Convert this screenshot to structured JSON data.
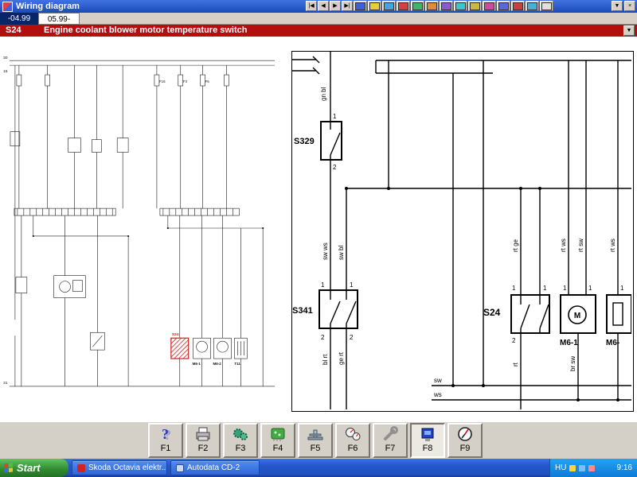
{
  "titlebar": {
    "title": "Wiring diagram",
    "nav_first": "|◀",
    "nav_prev": "◀",
    "nav_next": "▶",
    "nav_last": "▶|",
    "dropdown": "▼",
    "close": "×"
  },
  "date_tabs": {
    "tab1": "-04.99",
    "tab2": "05.99-"
  },
  "banner": {
    "code": "S24",
    "title": "Engine coolant blower motor temperature switch",
    "dropdown": "▼"
  },
  "left_diagram": {
    "bus30": "30",
    "bus15": "15",
    "ground31": "31",
    "f16": "F16",
    "f3": "F3",
    "f6": "F6",
    "s24": "S24",
    "m6_1": "M6-1",
    "m6_2": "M6-2",
    "t11": "T11"
  },
  "right_diagram": {
    "s329": "S329",
    "s341": "S341",
    "s24": "S24",
    "m6_1": "M6-1",
    "m6_part": "M6-",
    "motor": "M",
    "pin1": "1",
    "pin2": "2",
    "gn_bl": "gn bl",
    "sw_ws": "sw ws",
    "sw_bl": "sw bl",
    "bl_rt": "bl rt",
    "ge_rt": "ge rt",
    "rt_ge": "rt ge",
    "rt_ws": "rt ws",
    "rt_sw": "rt sw",
    "rt_ws2": "rt ws",
    "rt": "rt",
    "br_sw": "br sw",
    "sw": "sw",
    "ws": "ws"
  },
  "fkeys": {
    "f1": "F1",
    "f2": "F2",
    "f3": "F3",
    "f4": "F4",
    "f5": "F5",
    "f6": "F6",
    "f7": "F7",
    "f8": "F8",
    "f9": "F9"
  },
  "taskbar": {
    "start": "Start",
    "task1": "Skoda Octavia elektr...",
    "task2": "Autodata CD-2",
    "lang": "HU",
    "time": "9:16"
  },
  "colors": {
    "banner_red": "#b30f0f",
    "titlebar_blue": "#2b5fd0",
    "taskbar_blue": "#2456c8",
    "start_green": "#2f8a2f",
    "selected_tab_blue": "#0a246a",
    "highlight_component_red": "#cc2222"
  },
  "icon_names": {
    "fkeys": [
      "help-icon",
      "printer-icon",
      "gears-icon",
      "circuit-board-icon",
      "lift-icon",
      "gauges-icon",
      "wrench-icon",
      "diagnostic-screen-icon",
      "compass-icon"
    ],
    "tray": [
      "tray-icon-1",
      "tray-icon-2",
      "tray-icon-3"
    ],
    "titlebar": [
      "toolbar-icon-1",
      "toolbar-icon-2",
      "toolbar-icon-3",
      "toolbar-icon-4",
      "toolbar-icon-5",
      "toolbar-icon-6",
      "toolbar-icon-7",
      "toolbar-icon-8",
      "toolbar-icon-9",
      "toolbar-icon-10",
      "toolbar-icon-11",
      "toolbar-icon-12",
      "toolbar-icon-13",
      "toolbar-icon-14"
    ]
  }
}
